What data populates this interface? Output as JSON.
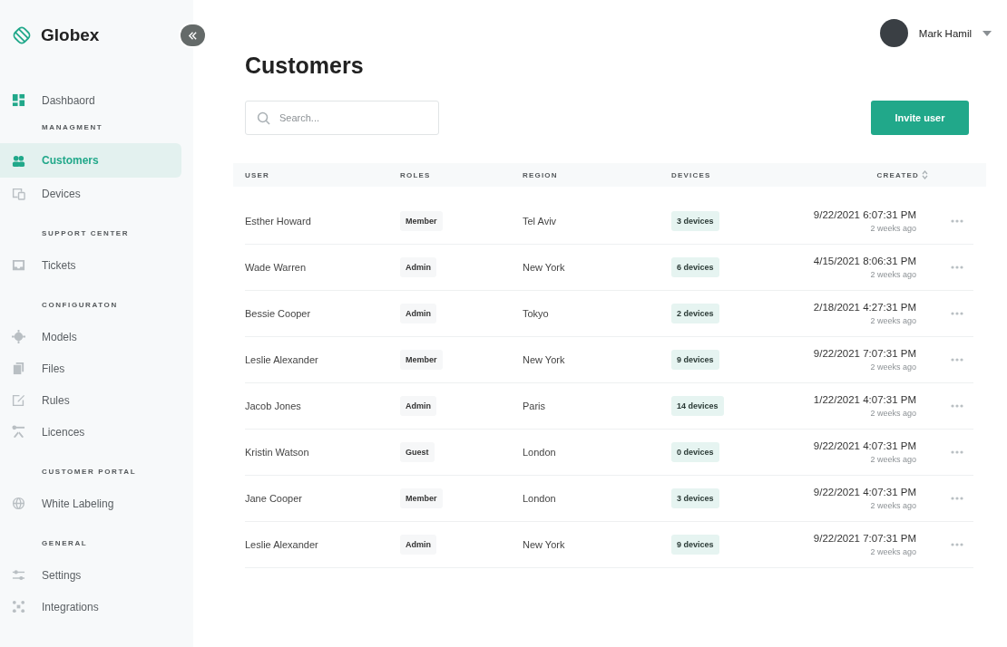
{
  "brand": {
    "name": "Globex"
  },
  "sidebar": {
    "groups": [
      {
        "items": [
          {
            "label": "Dashbaord",
            "selected": false
          }
        ]
      },
      {
        "heading": "MANAGMENT",
        "items": [
          {
            "label": "Customers",
            "selected": true
          },
          {
            "label": "Devices",
            "selected": false
          }
        ]
      },
      {
        "heading": "SUPPORT CENTER",
        "items": [
          {
            "label": "Tickets",
            "selected": false
          }
        ]
      },
      {
        "heading": "CONFIGURATON",
        "items": [
          {
            "label": "Models",
            "selected": false
          },
          {
            "label": "Files",
            "selected": false
          },
          {
            "label": "Rules",
            "selected": false
          },
          {
            "label": "Licences",
            "selected": false
          }
        ]
      },
      {
        "heading": "CUSTOMER PORTAL",
        "items": [
          {
            "label": "White Labeling",
            "selected": false
          }
        ]
      },
      {
        "heading": "GENERAL",
        "items": [
          {
            "label": "Settings",
            "selected": false
          },
          {
            "label": "Integrations",
            "selected": false
          }
        ]
      }
    ]
  },
  "user": {
    "name": "Mark Hamil"
  },
  "page": {
    "title": "Customers"
  },
  "search": {
    "placeholder": "Search..."
  },
  "invite_button": "Invite user",
  "table": {
    "columns": [
      "USER",
      "ROLES",
      "REGION",
      "DEVICES",
      "CREATED"
    ],
    "rows": [
      {
        "user": "Esther Howard",
        "role": "Member",
        "region": "Tel Aviv",
        "devices": "3 devices",
        "created": "9/22/2021 6:07:31 PM",
        "ago": "2 weeks ago"
      },
      {
        "user": "Wade Warren",
        "role": "Admin",
        "region": "New York",
        "devices": "6 devices",
        "created": "4/15/2021 8:06:31 PM",
        "ago": "2 weeks ago"
      },
      {
        "user": "Bessie Cooper",
        "role": "Admin",
        "region": "Tokyo",
        "devices": "2 devices",
        "created": "2/18/2021 4:27:31 PM",
        "ago": "2 weeks ago"
      },
      {
        "user": "Leslie Alexander",
        "role": "Member",
        "region": "New York",
        "devices": "9 devices",
        "created": "9/22/2021 7:07:31 PM",
        "ago": "2 weeks ago"
      },
      {
        "user": "Jacob Jones",
        "role": "Admin",
        "region": "Paris",
        "devices": "14 devices",
        "created": "1/22/2021 4:07:31 PM",
        "ago": "2 weeks ago"
      },
      {
        "user": "Kristin Watson",
        "role": "Guest",
        "region": "London",
        "devices": "0 devices",
        "created": "9/22/2021 4:07:31 PM",
        "ago": "2 weeks ago"
      },
      {
        "user": "Jane Cooper",
        "role": "Member",
        "region": "London",
        "devices": "3 devices",
        "created": "9/22/2021 4:07:31 PM",
        "ago": "2 weeks ago"
      },
      {
        "user": "Leslie Alexander",
        "role": "Admin",
        "region": "New York",
        "devices": "9 devices",
        "created": "9/22/2021 7:07:31 PM",
        "ago": "2 weeks ago"
      }
    ]
  }
}
